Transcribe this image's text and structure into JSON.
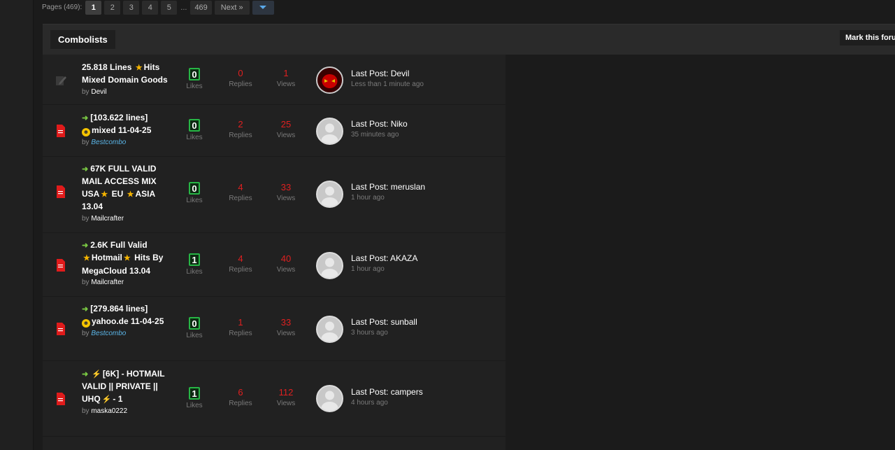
{
  "pagination": {
    "label": "Pages (469):",
    "pages": [
      "1",
      "2",
      "3",
      "4",
      "5"
    ],
    "dots": "...",
    "last": "469",
    "next": "Next »",
    "dropdown_icon": "chevron-down-icon"
  },
  "forum": {
    "title": "Combolists",
    "mark_read": "Mark this forum read"
  },
  "colors": {
    "accent_blue": "#5aa9ea",
    "count_red": "#e02020",
    "likes_green": "#27b545",
    "special_user": "#5ab4e6"
  },
  "threads": [
    {
      "title_parts": [
        "25.818 Lines ",
        "Hits Mixed Domain Goods"
      ],
      "by": "by",
      "author": "Devil",
      "likes": "0",
      "likes_label": "Likes",
      "replies": "0",
      "replies_label": "Replies",
      "views": "1",
      "views_label": "Views",
      "lastpost_label": "Last Post",
      "lastpost_user": "Devil",
      "lastpost_time": "Less than 1 minute ago",
      "icon": "pencil-icon",
      "avatar": "devil-avatar"
    },
    {
      "title_parts": [
        "[103.622 lines]",
        "mixed 11-04-25"
      ],
      "by": "by",
      "author": "Bestcombo",
      "likes": "0",
      "likes_label": "Likes",
      "replies": "2",
      "replies_label": "Replies",
      "views": "25",
      "views_label": "Views",
      "lastpost_label": "Last Post",
      "lastpost_user": "Niko",
      "lastpost_time": "35 minutes ago",
      "icon": "document-icon",
      "avatar": "default-avatar"
    },
    {
      "title_parts": [
        "67K FULL VALID MAIL ACCESS MIX USA",
        "EU",
        "ASIA 13.04"
      ],
      "by": "by",
      "author": "Mailcrafter",
      "likes": "0",
      "likes_label": "Likes",
      "replies": "4",
      "replies_label": "Replies",
      "views": "33",
      "views_label": "Views",
      "lastpost_label": "Last Post",
      "lastpost_user": "meruslan",
      "lastpost_time": "1 hour ago",
      "icon": "document-icon",
      "avatar": "default-avatar"
    },
    {
      "title_parts": [
        "2.6K Full Valid",
        "Hotmail",
        "Hits By MegaCloud 13.04"
      ],
      "by": "by",
      "author": "Mailcrafter",
      "likes": "1",
      "likes_label": "Likes",
      "replies": "4",
      "replies_label": "Replies",
      "views": "40",
      "views_label": "Views",
      "lastpost_label": "Last Post",
      "lastpost_user": "AKAZA",
      "lastpost_time": "1 hour ago",
      "icon": "document-icon",
      "avatar": "default-avatar"
    },
    {
      "title_parts": [
        "[279.864 lines]",
        "yahoo.de 11-04-25"
      ],
      "by": "by",
      "author": "Bestcombo",
      "likes": "0",
      "likes_label": "Likes",
      "replies": "1",
      "replies_label": "Replies",
      "views": "33",
      "views_label": "Views",
      "lastpost_label": "Last Post",
      "lastpost_user": "sunball",
      "lastpost_time": "3 hours ago",
      "icon": "document-icon",
      "avatar": "default-avatar"
    },
    {
      "title_parts": [
        "[6K] - HOTMAIL VALID || PRIVATE || UHQ",
        "- 1"
      ],
      "by": "by",
      "author": "maska0222",
      "likes": "1",
      "likes_label": "Likes",
      "replies": "6",
      "replies_label": "Replies",
      "views": "112",
      "views_label": "Views",
      "lastpost_label": "Last Post",
      "lastpost_user": "campers",
      "lastpost_time": "4 hours ago",
      "icon": "document-icon",
      "avatar": "default-avatar"
    }
  ]
}
